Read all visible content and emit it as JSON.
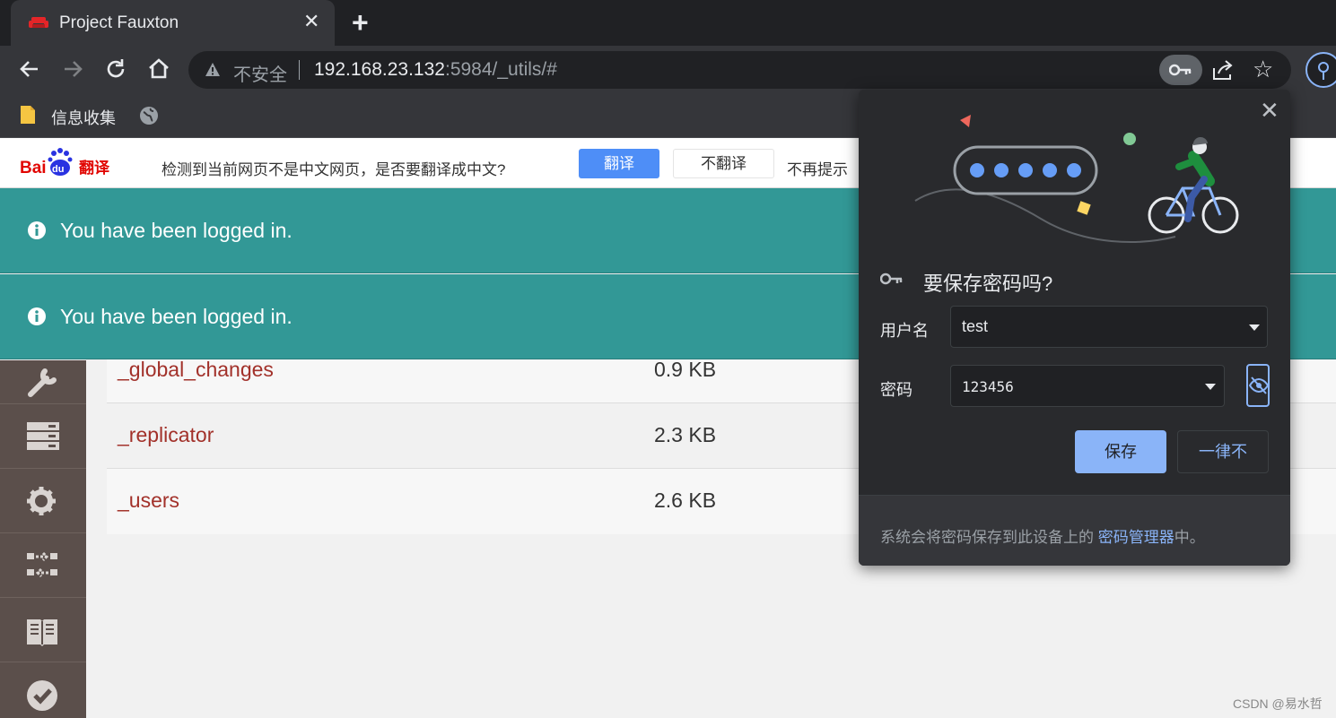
{
  "tab": {
    "title": "Project Fauxton",
    "close_glyph": "✕",
    "new_tab_glyph": "+"
  },
  "toolbar": {
    "not_secure": "不安全",
    "url_host": "192.168.23.132",
    "url_rest": ":5984/_utils/#",
    "star_glyph": "☆"
  },
  "bookmarks": {
    "items": [
      {
        "label": "信息收集",
        "icon": "folder-icon"
      }
    ]
  },
  "translate_bar": {
    "message": "检测到当前网页不是中文网页，是否要翻译成中文?",
    "translate_label": "翻译",
    "no_translate_label": "不翻译",
    "no_remind_label": "不再提示",
    "logo_text": "Bai",
    "logo_text_2": "du",
    "logo_text_3": "翻译"
  },
  "alerts": [
    {
      "text": "You have been logged in."
    },
    {
      "text": "You have been logged in."
    }
  ],
  "databases": [
    {
      "name": "_global_changes",
      "size": "0.9 KB"
    },
    {
      "name": "_replicator",
      "size": "2.3 KB"
    },
    {
      "name": "_users",
      "size": "2.6 KB"
    }
  ],
  "sidebar": {
    "items": [
      {
        "icon": "wrench-icon"
      },
      {
        "icon": "server-icon"
      },
      {
        "icon": "gear-icon"
      },
      {
        "icon": "replication-icon"
      },
      {
        "icon": "book-icon"
      },
      {
        "icon": "check-circle-icon"
      }
    ]
  },
  "password_bubble": {
    "title": "要保存密码吗?",
    "username_label": "用户名",
    "username_value": "test",
    "password_label": "密码",
    "password_value": "123456",
    "save_label": "保存",
    "never_label": "一律不",
    "footer_prefix": "系统会将密码保存到此设备上的 ",
    "footer_link": "密码管理器",
    "footer_suffix": "中。",
    "close_glyph": "✕"
  },
  "watermark": "CSDN @易水哲",
  "colors": {
    "alert_bg": "#329896",
    "db_link": "#a2312a",
    "sidebar_bg": "#5b4f4b",
    "chrome_dark": "#202124",
    "chrome_accent": "#8ab4f8",
    "translate_btn": "#4e8ef7"
  }
}
